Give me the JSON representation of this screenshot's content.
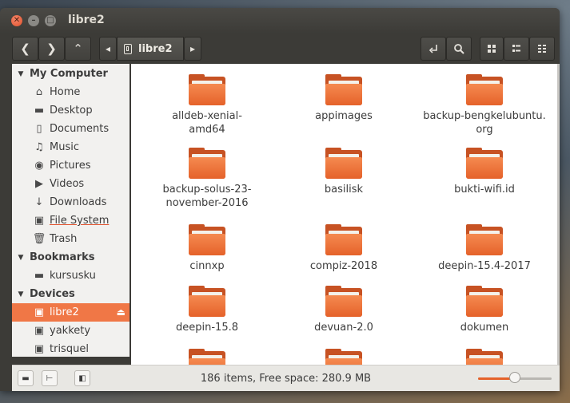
{
  "window": {
    "title": "libre2"
  },
  "toolbar": {
    "back_glyph": "❮",
    "forward_glyph": "❯",
    "up_glyph": "⌃",
    "path_left_glyph": "◂",
    "path_right_glyph": "▸",
    "current_folder": "libre2"
  },
  "sidebar": {
    "my_computer": "My Computer",
    "bookmarks": "Bookmarks",
    "devices": "Devices",
    "items": [
      {
        "label": "Home",
        "icon": "home-icon"
      },
      {
        "label": "Desktop",
        "icon": "folder-icon"
      },
      {
        "label": "Documents",
        "icon": "document-icon"
      },
      {
        "label": "Music",
        "icon": "music-icon"
      },
      {
        "label": "Pictures",
        "icon": "camera-icon"
      },
      {
        "label": "Videos",
        "icon": "video-icon"
      },
      {
        "label": "Downloads",
        "icon": "download-icon"
      },
      {
        "label": "File System",
        "icon": "drive-icon"
      },
      {
        "label": "Trash",
        "icon": "trash-icon"
      }
    ],
    "bookmark_items": [
      {
        "label": "kursusku"
      }
    ],
    "device_items": [
      {
        "label": "libre2",
        "selected": true
      },
      {
        "label": "yakkety"
      },
      {
        "label": "trisquel"
      }
    ]
  },
  "files": [
    {
      "name": "alldeb-xenial-amd64"
    },
    {
      "name": "appimages"
    },
    {
      "name": "backup-bengkelubuntu.org"
    },
    {
      "name": "backup-solus-23-november-2016"
    },
    {
      "name": "basilisk"
    },
    {
      "name": "bukti-wifi.id"
    },
    {
      "name": "cinnxp"
    },
    {
      "name": "compiz-2018"
    },
    {
      "name": "deepin-15.4-2017"
    },
    {
      "name": "deepin-15.8"
    },
    {
      "name": "devuan-2.0"
    },
    {
      "name": "dokumen"
    }
  ],
  "status": {
    "text": "186 items, Free space: 280.9 MB",
    "zoom_level": 0.5
  },
  "colors": {
    "accent": "#f07746",
    "folder": "#e5622a"
  }
}
